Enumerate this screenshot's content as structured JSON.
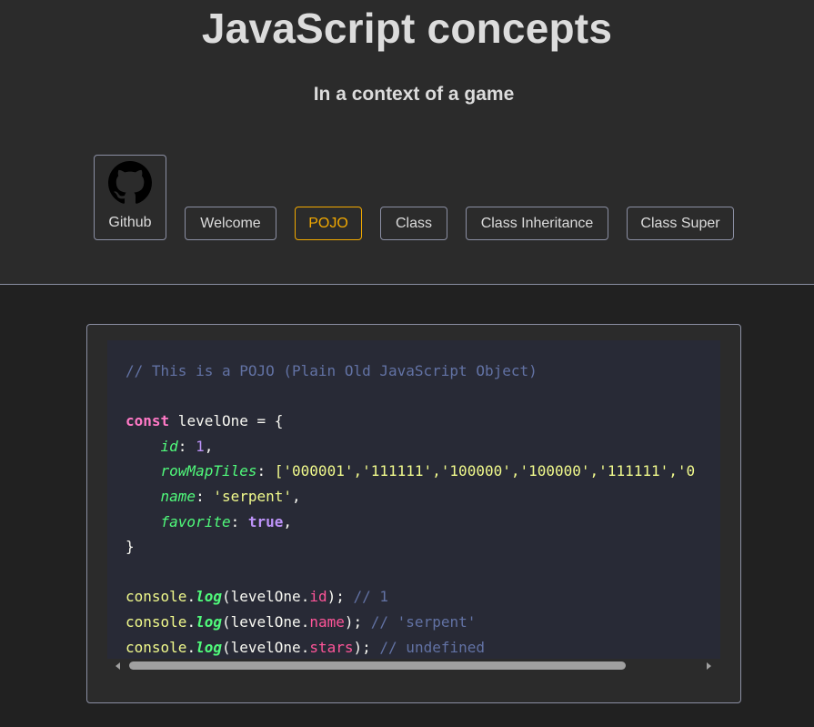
{
  "header": {
    "title": "JavaScript concepts",
    "subtitle": "In a context of a game"
  },
  "nav": {
    "github": {
      "label": "Github",
      "icon": "github-icon"
    },
    "items": [
      {
        "label": "Welcome",
        "active": false
      },
      {
        "label": "POJO",
        "active": true
      },
      {
        "label": "Class",
        "active": false
      },
      {
        "label": "Class Inheritance",
        "active": false
      },
      {
        "label": "Class Super",
        "active": false
      }
    ],
    "accent_color": "#f2a900"
  },
  "code": {
    "language": "javascript",
    "lines": {
      "comment": "// This is a POJO (Plain Old JavaScript Object)",
      "const_kw": "const",
      "decl_rest": " levelOne = {",
      "id_key": "id",
      "id_val": "1",
      "tiles_key": "rowMapTiles",
      "tiles_val": "['000001','111111','100000','100000','111111','0",
      "name_key": "name",
      "name_val": "'serpent'",
      "fav_key": "favorite",
      "fav_val": "true",
      "close": "}",
      "console": "console",
      "log": "log",
      "obj": "levelOne",
      "m1": "id",
      "c1": "// 1",
      "m2": "name",
      "c2": "// 'serpent'",
      "m3": "stars",
      "c3": "// undefined"
    }
  },
  "scrollbar": {
    "horizontal_position_fraction": 0.0,
    "visible_fraction": 0.85
  }
}
